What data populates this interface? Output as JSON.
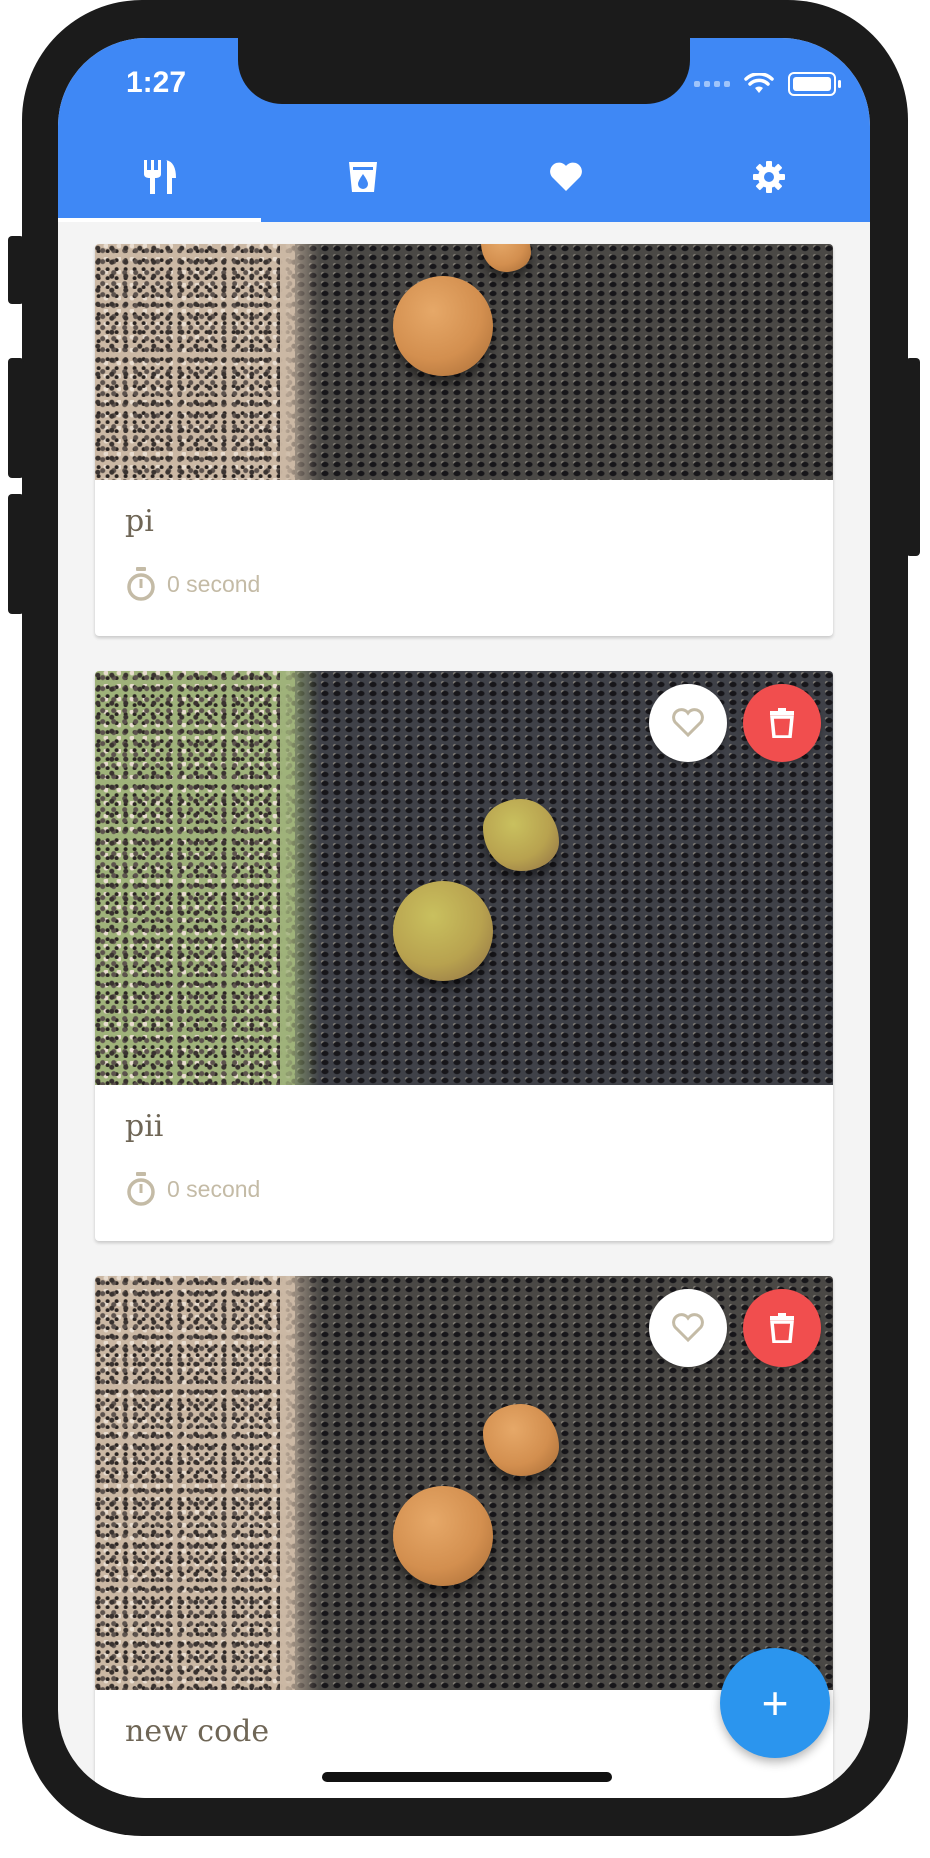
{
  "status_bar": {
    "time": "1:27"
  },
  "tabs": [
    {
      "name": "meals",
      "icon": "fork-knife-icon"
    },
    {
      "name": "drinks",
      "icon": "cup-icon"
    },
    {
      "name": "favorites",
      "icon": "heart-icon"
    },
    {
      "name": "settings",
      "icon": "gear-icon"
    }
  ],
  "active_tab": "meals",
  "cards": [
    {
      "title": "pi",
      "duration": "0 second"
    },
    {
      "title": "pii",
      "duration": "0 second"
    },
    {
      "title": "new code"
    }
  ],
  "fab": {
    "label": "+"
  },
  "colors": {
    "appbar": "#3f88f5",
    "delete": "#f14e4e",
    "fab": "#2b95ee",
    "meta": "#c4bba6",
    "title": "#6f6656"
  }
}
